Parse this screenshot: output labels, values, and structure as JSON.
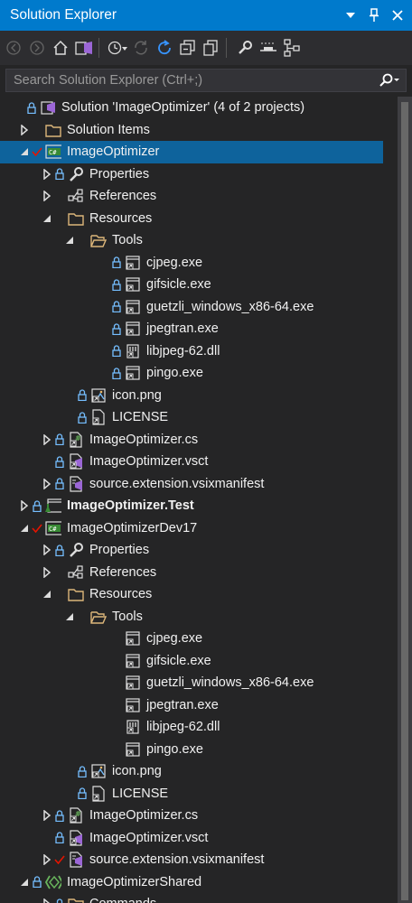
{
  "window": {
    "title": "Solution Explorer"
  },
  "search": {
    "placeholder": "Search Solution Explorer (Ctrl+;)"
  },
  "colors": {
    "accent": "#007acc",
    "selected": "#0e639c",
    "background": "#252526",
    "folder": "#dcb67a",
    "check": "#e51400",
    "lock": "#75beff"
  },
  "tree": [
    {
      "label": "Solution 'ImageOptimizer' (4 of 2 projects)",
      "indent": 0,
      "arrow": "none",
      "lock": true,
      "icon": "solution-icon"
    },
    {
      "label": "Solution Items",
      "indent": 1,
      "arrow": "right",
      "lock": false,
      "icon": "folder-icon"
    },
    {
      "label": "ImageOptimizer",
      "indent": 1,
      "arrow": "down",
      "lock": false,
      "check": true,
      "icon": "csharp-project-icon",
      "selected": true
    },
    {
      "label": "Properties",
      "indent": 2,
      "arrow": "right",
      "lock": true,
      "icon": "wrench-icon"
    },
    {
      "label": "References",
      "indent": 2,
      "arrow": "right",
      "lock": false,
      "icon": "references-icon"
    },
    {
      "label": "Resources",
      "indent": 2,
      "arrow": "down",
      "lock": false,
      "icon": "folder-icon"
    },
    {
      "label": "Tools",
      "indent": 3,
      "arrow": "down",
      "lock": false,
      "icon": "folder-open-icon"
    },
    {
      "label": "cjpeg.exe",
      "indent": 4,
      "arrow": "none",
      "lock": true,
      "icon": "exe-file-icon"
    },
    {
      "label": "gifsicle.exe",
      "indent": 4,
      "arrow": "none",
      "lock": true,
      "icon": "exe-file-icon"
    },
    {
      "label": "guetzli_windows_x86-64.exe",
      "indent": 4,
      "arrow": "none",
      "lock": true,
      "icon": "exe-file-icon"
    },
    {
      "label": "jpegtran.exe",
      "indent": 4,
      "arrow": "none",
      "lock": true,
      "icon": "exe-file-icon"
    },
    {
      "label": "libjpeg-62.dll",
      "indent": 4,
      "arrow": "none",
      "lock": true,
      "icon": "dll-file-icon"
    },
    {
      "label": "pingo.exe",
      "indent": 4,
      "arrow": "none",
      "lock": true,
      "icon": "exe-file-icon"
    },
    {
      "label": "icon.png",
      "indent": 3,
      "arrow": "none",
      "lock": true,
      "icon": "image-file-icon"
    },
    {
      "label": "LICENSE",
      "indent": 3,
      "arrow": "none",
      "lock": true,
      "icon": "text-file-icon"
    },
    {
      "label": "ImageOptimizer.cs",
      "indent": 2,
      "arrow": "right",
      "lock": true,
      "icon": "csharp-file-icon"
    },
    {
      "label": "ImageOptimizer.vsct",
      "indent": 2,
      "arrow": "none",
      "lock": true,
      "icon": "vsct-file-icon"
    },
    {
      "label": "source.extension.vsixmanifest",
      "indent": 2,
      "arrow": "right",
      "lock": true,
      "icon": "manifest-file-icon"
    },
    {
      "label": "ImageOptimizer.Test",
      "indent": 1,
      "arrow": "right",
      "lock": true,
      "icon": "test-project-icon",
      "bold": true
    },
    {
      "label": "ImageOptimizerDev17",
      "indent": 1,
      "arrow": "down",
      "lock": false,
      "check": true,
      "icon": "csharp-project-icon"
    },
    {
      "label": "Properties",
      "indent": 2,
      "arrow": "right",
      "lock": true,
      "icon": "wrench-icon"
    },
    {
      "label": "References",
      "indent": 2,
      "arrow": "right",
      "lock": false,
      "icon": "references-icon"
    },
    {
      "label": "Resources",
      "indent": 2,
      "arrow": "down",
      "lock": false,
      "icon": "folder-icon"
    },
    {
      "label": "Tools",
      "indent": 3,
      "arrow": "down",
      "lock": false,
      "icon": "folder-open-icon"
    },
    {
      "label": "cjpeg.exe",
      "indent": 4,
      "arrow": "none",
      "lock": false,
      "icon": "exe-file-icon"
    },
    {
      "label": "gifsicle.exe",
      "indent": 4,
      "arrow": "none",
      "lock": false,
      "icon": "exe-file-icon"
    },
    {
      "label": "guetzli_windows_x86-64.exe",
      "indent": 4,
      "arrow": "none",
      "lock": false,
      "icon": "exe-file-icon"
    },
    {
      "label": "jpegtran.exe",
      "indent": 4,
      "arrow": "none",
      "lock": false,
      "icon": "exe-file-icon"
    },
    {
      "label": "libjpeg-62.dll",
      "indent": 4,
      "arrow": "none",
      "lock": false,
      "icon": "dll-file-icon"
    },
    {
      "label": "pingo.exe",
      "indent": 4,
      "arrow": "none",
      "lock": false,
      "icon": "exe-file-icon"
    },
    {
      "label": "icon.png",
      "indent": 3,
      "arrow": "none",
      "lock": true,
      "icon": "image-file-icon"
    },
    {
      "label": "LICENSE",
      "indent": 3,
      "arrow": "none",
      "lock": true,
      "icon": "text-file-icon"
    },
    {
      "label": "ImageOptimizer.cs",
      "indent": 2,
      "arrow": "right",
      "lock": true,
      "icon": "csharp-file-icon"
    },
    {
      "label": "ImageOptimizer.vsct",
      "indent": 2,
      "arrow": "none",
      "lock": true,
      "icon": "vsct-file-icon"
    },
    {
      "label": "source.extension.vsixmanifest",
      "indent": 2,
      "arrow": "right",
      "lock": false,
      "check": true,
      "icon": "manifest-file-icon"
    },
    {
      "label": "ImageOptimizerShared",
      "indent": 1,
      "arrow": "down",
      "lock": true,
      "icon": "shared-project-icon"
    },
    {
      "label": "Commands",
      "indent": 2,
      "arrow": "right",
      "lock": true,
      "icon": "folder-icon"
    }
  ]
}
